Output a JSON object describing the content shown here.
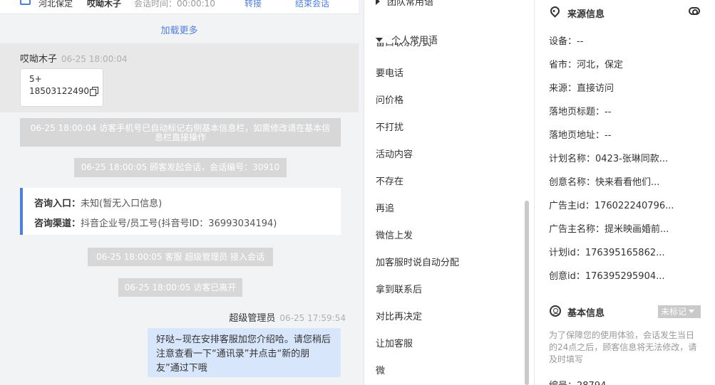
{
  "chat": {
    "header": {
      "location": "河北保定",
      "visitor": "哎呦木子",
      "duration_label": "会话时间：00:00:10",
      "transfer": "转接",
      "end": "结束会话"
    },
    "load_more": "加载更多",
    "visitor_msg": {
      "sender": "哎呦木子",
      "time": "06-25 18:00:04",
      "line1": "5+",
      "line2": "18503122490"
    },
    "system_1": "06-25 18:00:04 访客手机号已自动标记右侧基本信息栏，如需修改请在基本信息栏直接操作",
    "system_2": "06-25 18:00:05 顾客发起会话，会话编号：30910",
    "consult": {
      "entry_label": "咨询入口：",
      "entry_value": "未知(暂无入口信息)",
      "channel_label": "咨询渠道：",
      "channel_value": "抖音企业号/员工号(抖音号ID：36993034194)"
    },
    "system_3": "06-25 18:00:05 客服 超级管理员 接入会话",
    "system_4": "06-25 18:00:05 访客已离开",
    "agent_msg": {
      "sender": "超级管理员",
      "time": "06-25 17:59:54",
      "text": "好哒~现在安排客服加您介绍哈。请您稍后注意查看一下“通讯录”并点击“新的朋友”通过下哦"
    }
  },
  "phrases": {
    "team_group": "团队常用语",
    "personal_group": "个人常用语",
    "partial_item": "留口联系方式",
    "items": [
      "要电话",
      "问价格",
      "不打扰",
      "活动内容",
      "不存在",
      "再追",
      "微信上发",
      "加客服时说自动分配",
      "拿到联系后",
      "对比再决定",
      "让加客服",
      "微"
    ]
  },
  "info": {
    "source_title": "来源信息",
    "fields": [
      "设备：--",
      "省市：河北，保定",
      "来源：直接访问",
      "落地页标题：--",
      "落地页地址：--",
      "计划名称：0423-张琳同款...",
      "创意名称：快来看看他们...",
      "广告主id：176022240796...",
      "广告主名称：提米映画婚前...",
      "计划id：176395165862...",
      "创意id：176395295904..."
    ],
    "basic_title": "基本信息",
    "badge": "未标记",
    "hint": "为了保障您的使用体验，会话发生当日的24点之后，顾客信息将无法修改，请及时填写",
    "number_row": "编号：28794"
  }
}
